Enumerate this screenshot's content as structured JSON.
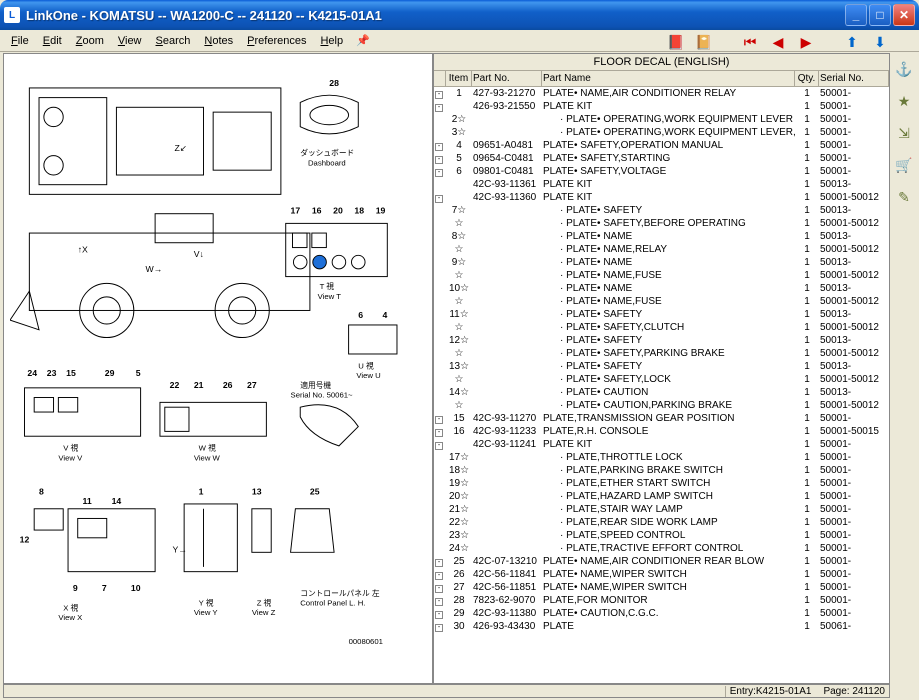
{
  "window": {
    "title": "LinkOne - KOMATSU -- WA1200-C -- 241120 -- K4215-01A1",
    "icon_glyph": "L"
  },
  "menu": {
    "file": "File",
    "edit": "Edit",
    "zoom": "Zoom",
    "view": "View",
    "search": "Search",
    "notes": "Notes",
    "preferences": "Preferences",
    "help": "Help"
  },
  "nav_icons": {
    "books": "📕",
    "copy": "📔",
    "first": "⏮",
    "prev": "◀",
    "next": "▶",
    "up": "⬆",
    "down": "⬇"
  },
  "side": {
    "anchor": "⚓",
    "star": "★",
    "link": "⇲",
    "cart": "🛒",
    "flag": "✎"
  },
  "table": {
    "title": "FLOOR DECAL (ENGLISH)",
    "cols": {
      "item": "Item",
      "partno": "Part No.",
      "partname": "Part Name",
      "qty": "Qty.",
      "serial": "Serial No."
    },
    "rows": [
      {
        "box": "-",
        "item": "1",
        "partno": "427-93-21270",
        "name": "PLATE• NAME,AIR CONDITIONER RELAY",
        "qty": "1",
        "serial": "50001-"
      },
      {
        "box": "-",
        "item": "",
        "partno": "426-93-21550",
        "name": "PLATE KIT",
        "qty": "1",
        "serial": "50001-"
      },
      {
        "box": "",
        "item": "2",
        "star": true,
        "partno": "",
        "indent": true,
        "dot": true,
        "name": "PLATE• OPERATING,WORK EQUIPMENT LEVER",
        "qty": "1",
        "serial": "50001-"
      },
      {
        "box": "",
        "item": "3",
        "star": true,
        "partno": "",
        "indent": true,
        "dot": true,
        "name": "PLATE• OPERATING,WORK EQUIPMENT LEVER,LOCK",
        "qty": "1",
        "serial": "50001-"
      },
      {
        "box": "-",
        "item": "4",
        "partno": "09651-A0481",
        "name": "PLATE• SAFETY,OPERATION MANUAL",
        "qty": "1",
        "serial": "50001-"
      },
      {
        "box": "-",
        "item": "5",
        "partno": "09654-C0481",
        "name": "PLATE• SAFETY,STARTING",
        "qty": "1",
        "serial": "50001-"
      },
      {
        "box": "-",
        "item": "6",
        "partno": "09801-C0481",
        "name": "PLATE• SAFETY,VOLTAGE",
        "qty": "1",
        "serial": "50001-"
      },
      {
        "box": "",
        "item": "",
        "partno": "42C-93-11361",
        "name": "PLATE KIT",
        "qty": "1",
        "serial": "50013-"
      },
      {
        "box": "-",
        "item": "",
        "partno": "42C-93-11360",
        "name": "PLATE KIT",
        "qty": "1",
        "serial": "50001-50012"
      },
      {
        "box": "",
        "item": "7",
        "star": true,
        "partno": "",
        "indent": true,
        "dot": true,
        "name": "PLATE• SAFETY",
        "qty": "1",
        "serial": "50013-"
      },
      {
        "box": "",
        "item": "",
        "star": true,
        "partno": "",
        "indent": true,
        "dot": true,
        "name": "PLATE• SAFETY,BEFORE OPERATING",
        "qty": "1",
        "serial": "50001-50012"
      },
      {
        "box": "",
        "item": "8",
        "star": true,
        "partno": "",
        "indent": true,
        "dot": true,
        "name": "PLATE• NAME",
        "qty": "1",
        "serial": "50013-"
      },
      {
        "box": "",
        "item": "",
        "star": true,
        "partno": "",
        "indent": true,
        "dot": true,
        "name": "PLATE• NAME,RELAY",
        "qty": "1",
        "serial": "50001-50012"
      },
      {
        "box": "",
        "item": "9",
        "star": true,
        "partno": "",
        "indent": true,
        "dot": true,
        "name": "PLATE• NAME",
        "qty": "1",
        "serial": "50013-"
      },
      {
        "box": "",
        "item": "",
        "star": true,
        "partno": "",
        "indent": true,
        "dot": true,
        "name": "PLATE• NAME,FUSE",
        "qty": "1",
        "serial": "50001-50012"
      },
      {
        "box": "",
        "item": "10",
        "star": true,
        "partno": "",
        "indent": true,
        "dot": true,
        "name": "PLATE• NAME",
        "qty": "1",
        "serial": "50013-"
      },
      {
        "box": "",
        "item": "",
        "star": true,
        "partno": "",
        "indent": true,
        "dot": true,
        "name": "PLATE• NAME,FUSE",
        "qty": "1",
        "serial": "50001-50012"
      },
      {
        "box": "",
        "item": "11",
        "star": true,
        "partno": "",
        "indent": true,
        "dot": true,
        "name": "PLATE• SAFETY",
        "qty": "1",
        "serial": "50013-"
      },
      {
        "box": "",
        "item": "",
        "star": true,
        "partno": "",
        "indent": true,
        "dot": true,
        "name": "PLATE• SAFETY,CLUTCH",
        "qty": "1",
        "serial": "50001-50012"
      },
      {
        "box": "",
        "item": "12",
        "star": true,
        "partno": "",
        "indent": true,
        "dot": true,
        "name": "PLATE• SAFETY",
        "qty": "1",
        "serial": "50013-"
      },
      {
        "box": "",
        "item": "",
        "star": true,
        "partno": "",
        "indent": true,
        "dot": true,
        "name": "PLATE• SAFETY,PARKING BRAKE",
        "qty": "1",
        "serial": "50001-50012"
      },
      {
        "box": "",
        "item": "13",
        "star": true,
        "partno": "",
        "indent": true,
        "dot": true,
        "name": "PLATE• SAFETY",
        "qty": "1",
        "serial": "50013-"
      },
      {
        "box": "",
        "item": "",
        "star": true,
        "partno": "",
        "indent": true,
        "dot": true,
        "name": "PLATE• SAFETY,LOCK",
        "qty": "1",
        "serial": "50001-50012"
      },
      {
        "box": "",
        "item": "14",
        "star": true,
        "partno": "",
        "indent": true,
        "dot": true,
        "name": "PLATE• CAUTION",
        "qty": "1",
        "serial": "50013-"
      },
      {
        "box": "",
        "item": "",
        "star": true,
        "partno": "",
        "indent": true,
        "dot": true,
        "name": "PLATE• CAUTION,PARKING BRAKE",
        "qty": "1",
        "serial": "50001-50012"
      },
      {
        "box": "-",
        "item": "15",
        "partno": "42C-93-11270",
        "name": "PLATE,TRANSMISSION GEAR POSITION",
        "qty": "1",
        "serial": "50001-"
      },
      {
        "box": "-",
        "item": "16",
        "partno": "42C-93-11233",
        "name": "PLATE,R.H. CONSOLE",
        "qty": "1",
        "serial": "50001-50015"
      },
      {
        "box": "-",
        "item": "",
        "partno": "42C-93-11241",
        "name": "PLATE KIT",
        "qty": "1",
        "serial": "50001-"
      },
      {
        "box": "",
        "item": "17",
        "star": true,
        "partno": "",
        "indent": true,
        "dot": true,
        "name": "PLATE,THROTTLE LOCK",
        "qty": "1",
        "serial": "50001-"
      },
      {
        "box": "",
        "item": "18",
        "star": true,
        "partno": "",
        "indent": true,
        "dot": true,
        "name": "PLATE,PARKING BRAKE SWITCH",
        "qty": "1",
        "serial": "50001-"
      },
      {
        "box": "",
        "item": "19",
        "star": true,
        "partno": "",
        "indent": true,
        "dot": true,
        "name": "PLATE,ETHER START SWITCH",
        "qty": "1",
        "serial": "50001-"
      },
      {
        "box": "",
        "item": "20",
        "star": true,
        "partno": "",
        "indent": true,
        "dot": true,
        "name": "PLATE,HAZARD LAMP SWITCH",
        "qty": "1",
        "serial": "50001-"
      },
      {
        "box": "",
        "item": "21",
        "star": true,
        "partno": "",
        "indent": true,
        "dot": true,
        "name": "PLATE,STAIR WAY LAMP",
        "qty": "1",
        "serial": "50001-"
      },
      {
        "box": "",
        "item": "22",
        "star": true,
        "partno": "",
        "indent": true,
        "dot": true,
        "name": "PLATE,REAR SIDE WORK LAMP",
        "qty": "1",
        "serial": "50001-"
      },
      {
        "box": "",
        "item": "23",
        "star": true,
        "partno": "",
        "indent": true,
        "dot": true,
        "name": "PLATE,SPEED CONTROL",
        "qty": "1",
        "serial": "50001-"
      },
      {
        "box": "",
        "item": "24",
        "star": true,
        "partno": "",
        "indent": true,
        "dot": true,
        "name": "PLATE,TRACTIVE EFFORT CONTROL",
        "qty": "1",
        "serial": "50001-"
      },
      {
        "box": "-",
        "item": "25",
        "partno": "42C-07-13210",
        "name": "PLATE• NAME,AIR CONDITIONER REAR BLOW",
        "qty": "1",
        "serial": "50001-"
      },
      {
        "box": "-",
        "item": "26",
        "partno": "42C-56-11841",
        "name": "PLATE• NAME,WIPER SWITCH",
        "qty": "1",
        "serial": "50001-"
      },
      {
        "box": "-",
        "item": "27",
        "partno": "42C-56-11851",
        "name": "PLATE• NAME,WIPER SWITCH",
        "qty": "1",
        "serial": "50001-"
      },
      {
        "box": "-",
        "item": "28",
        "partno": "7823-62-9070",
        "name": "PLATE,FOR MONITOR",
        "qty": "1",
        "serial": "50001-"
      },
      {
        "box": "-",
        "item": "29",
        "partno": "42C-93-11380",
        "name": "PLATE• CAUTION,C.G.C.",
        "qty": "1",
        "serial": "50001-"
      },
      {
        "box": "-",
        "item": "30",
        "partno": "426-93-43430",
        "name": "PLATE",
        "qty": "1",
        "serial": "50061-"
      }
    ]
  },
  "status": {
    "entry_left": "Entry:K4215-01A1",
    "entry_right": "Page: 241120"
  },
  "diagram": {
    "callouts_top": [
      "28"
    ],
    "dashboard_jp": "ダッシュボード",
    "dashboard_en": "Dashboard",
    "callouts_mid": [
      "17",
      "16",
      "20",
      "18",
      "19"
    ],
    "view_t_jp": "T 視",
    "view_t_en": "View T",
    "six_four": [
      "6",
      "4"
    ],
    "left_row": [
      "24",
      "23",
      "15",
      "29",
      "5"
    ],
    "mid_row2": [
      "22",
      "21",
      "26",
      "27"
    ],
    "serial_jp": "適用号機",
    "serial_en": "Serial No. 50061~",
    "view_v_jp": "V 視",
    "view_v_en": "View V",
    "view_w_jp": "W 視",
    "view_w_en": "View W",
    "view_u_jp": "U 視",
    "view_u_en": "View U",
    "x_row": [
      "8",
      "11",
      "14",
      "12",
      "9",
      "7",
      "10"
    ],
    "one_thirteen_25": [
      "1",
      "13",
      "25"
    ],
    "view_x_jp": "X 視",
    "view_x_en": "View X",
    "view_y_jp": "Y 視",
    "view_y_en": "View Y",
    "view_z_jp": "Z 視",
    "view_z_en": "View Z",
    "control_panel_jp": "コントロールパネル 左",
    "control_panel_en": "Control Panel L. H.",
    "frame_no": "00080601"
  }
}
